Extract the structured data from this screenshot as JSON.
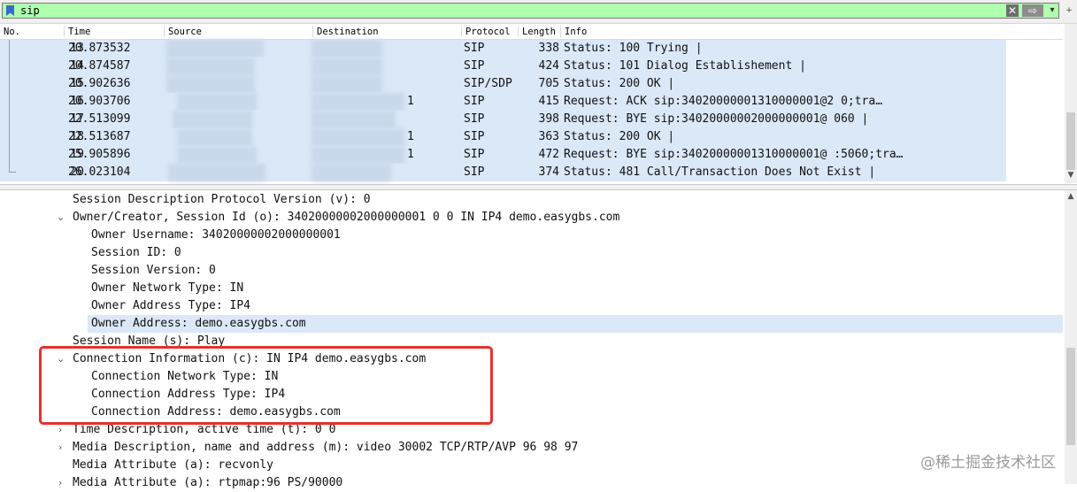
{
  "filter": {
    "value": "sip",
    "clear_glyph": "✕",
    "apply_glyph": "⇨",
    "dropdown_glyph": "▾"
  },
  "packet_columns": [
    "No.",
    "Time",
    "Source",
    "Destination",
    "Protocol",
    "Length",
    "Info"
  ],
  "packets": [
    {
      "no": "13",
      "time": "20.873532",
      "protocol": "SIP",
      "length": "338",
      "info": "Status: 100 Trying |",
      "extra": ""
    },
    {
      "no": "14",
      "time": "20.874587",
      "protocol": "SIP",
      "length": "424",
      "info": "Status: 101 Dialog Establishement |",
      "extra": ""
    },
    {
      "no": "15",
      "time": "20.902636",
      "protocol": "SIP/SDP",
      "length": "705",
      "info": "Status: 200 OK |",
      "extra": ""
    },
    {
      "no": "16",
      "time": "20.903706",
      "protocol": "SIP",
      "length": "415",
      "info": "Request: ACK sip:34020000001310000001@2                 0;tra…",
      "extra": "1"
    },
    {
      "no": "17",
      "time": "22.513099",
      "protocol": "SIP",
      "length": "398",
      "info": "Request: BYE sip:34020000002000000001@                 060 |",
      "extra": ""
    },
    {
      "no": "18",
      "time": "22.513687",
      "protocol": "SIP",
      "length": "363",
      "info": "Status: 200 OK |",
      "extra": "1"
    },
    {
      "no": "19",
      "time": "25.905896",
      "protocol": "SIP",
      "length": "472",
      "info": "Request: BYE sip:34020000001310000001@                 :5060;tra…",
      "extra": "1"
    },
    {
      "no": "20",
      "time": "26.023104",
      "protocol": "SIP",
      "length": "374",
      "info": "Status: 481 Call/Transaction Does Not Exist |",
      "extra": ""
    }
  ],
  "details": [
    {
      "indent": 1,
      "expander": "",
      "text": "Session Description Protocol Version (v): 0",
      "selected": false
    },
    {
      "indent": 1,
      "expander": "⌄",
      "text": "Owner/Creator, Session Id (o): 34020000002000000001 0 0 IN IP4 demo.easygbs.com",
      "selected": false
    },
    {
      "indent": 2,
      "expander": "",
      "text": "Owner Username: 34020000002000000001",
      "selected": false
    },
    {
      "indent": 2,
      "expander": "",
      "text": "Session ID: 0",
      "selected": false
    },
    {
      "indent": 2,
      "expander": "",
      "text": "Session Version: 0",
      "selected": false
    },
    {
      "indent": 2,
      "expander": "",
      "text": "Owner Network Type: IN",
      "selected": false
    },
    {
      "indent": 2,
      "expander": "",
      "text": "Owner Address Type: IP4",
      "selected": false
    },
    {
      "indent": 2,
      "expander": "",
      "text": "Owner Address: demo.easygbs.com",
      "selected": true
    },
    {
      "indent": 1,
      "expander": "",
      "text": "Session Name (s): Play",
      "selected": false
    },
    {
      "indent": 1,
      "expander": "⌄",
      "text": "Connection Information (c): IN IP4 demo.easygbs.com",
      "selected": false
    },
    {
      "indent": 2,
      "expander": "",
      "text": "Connection Network Type: IN",
      "selected": false
    },
    {
      "indent": 2,
      "expander": "",
      "text": "Connection Address Type: IP4",
      "selected": false
    },
    {
      "indent": 2,
      "expander": "",
      "text": "Connection Address: demo.easygbs.com",
      "selected": false
    },
    {
      "indent": 1,
      "expander": "›",
      "text": "Time Description, active time (t): 0 0",
      "selected": false
    },
    {
      "indent": 1,
      "expander": "›",
      "text": "Media Description, name and address (m): video 30002 TCP/RTP/AVP 96 98 97",
      "selected": false
    },
    {
      "indent": 1,
      "expander": "",
      "text": "Media Attribute (a): recvonly",
      "selected": false
    },
    {
      "indent": 1,
      "expander": "›",
      "text": "Media Attribute (a): rtpmap:96 PS/90000",
      "selected": false
    }
  ],
  "watermark": "@稀土掘金技术社区",
  "colors": {
    "filter_valid_bg": "#afffaf",
    "selection_bg": "#dae8f8",
    "annotation_red": "#e8302e"
  }
}
